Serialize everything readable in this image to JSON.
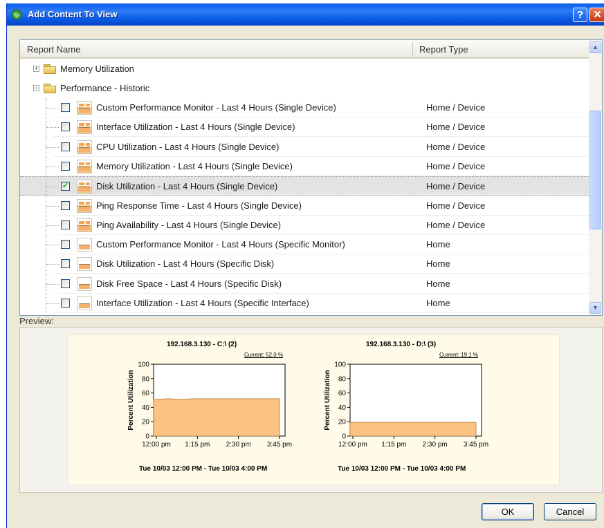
{
  "window": {
    "title": "Add Content To View",
    "help_label": "?",
    "close_label": "✕"
  },
  "list": {
    "headers": {
      "name": "Report Name",
      "type": "Report Type"
    },
    "folders": [
      {
        "label": "Memory Utilization",
        "expander": "+"
      },
      {
        "label": "Performance - Historic",
        "expander": "−"
      }
    ],
    "items": [
      {
        "name": "Custom Performance Monitor - Last 4 Hours (Single Device)",
        "type": "Home / Device",
        "checked": false,
        "check_mark": ""
      },
      {
        "name": "Interface Utilization - Last 4 Hours (Single Device)",
        "type": "Home / Device",
        "checked": false,
        "check_mark": ""
      },
      {
        "name": "CPU Utilization - Last 4 Hours (Single Device)",
        "type": "Home / Device",
        "checked": false,
        "check_mark": ""
      },
      {
        "name": "Memory Utilization - Last 4 Hours (Single Device)",
        "type": "Home / Device",
        "checked": false,
        "check_mark": ""
      },
      {
        "name": "Disk Utilization - Last 4 Hours (Single Device)",
        "type": "Home / Device",
        "checked": true,
        "check_mark": "✓"
      },
      {
        "name": "Ping Response Time - Last 4 Hours (Single Device)",
        "type": "Home / Device",
        "checked": false,
        "check_mark": ""
      },
      {
        "name": "Ping Availability - Last 4 Hours (Single Device)",
        "type": "Home / Device",
        "checked": false,
        "check_mark": ""
      },
      {
        "name": "Custom Performance Monitor - Last 4 Hours (Specific Monitor)",
        "type": "Home",
        "checked": false,
        "check_mark": ""
      },
      {
        "name": "Disk Utilization - Last 4 Hours (Specific Disk)",
        "type": "Home",
        "checked": false,
        "check_mark": ""
      },
      {
        "name": "Disk Free Space - Last 4 Hours (Specific Disk)",
        "type": "Home",
        "checked": false,
        "check_mark": ""
      },
      {
        "name": "Interface Utilization - Last 4 Hours (Specific Interface)",
        "type": "Home",
        "checked": false,
        "check_mark": ""
      }
    ],
    "scroll_up": "▲",
    "scroll_down": "▼"
  },
  "preview": {
    "label": "Preview:",
    "charts": [
      {
        "title": "192.168.3.130 - C:\\ (2)",
        "current": "Current: 52.0 %",
        "range": "Tue 10/03 12:00 PM - Tue 10/03 4:00 PM"
      },
      {
        "title": "192.168.3.130 - D:\\ (3)",
        "current": "Current: 19.1 %",
        "range": "Tue 10/03 12:00 PM - Tue 10/03 4:00 PM"
      }
    ]
  },
  "chart_data": [
    {
      "type": "area",
      "title": "192.168.3.130 - C:\\ (2)",
      "ylabel": "Percent Utilization",
      "ylim": [
        0,
        100
      ],
      "yticks": [
        0,
        20,
        40,
        60,
        80,
        100
      ],
      "xticks": [
        "12:00 pm",
        "1:15 pm",
        "2:30 pm",
        "3:45 pm"
      ],
      "x": [
        0,
        0.12,
        0.22,
        0.32,
        0.45,
        1.0
      ],
      "values": [
        51,
        52,
        51,
        52,
        52,
        52
      ],
      "current": 52.0,
      "color": "#fbc382"
    },
    {
      "type": "area",
      "title": "192.168.3.130 - D:\\ (3)",
      "ylabel": "Percent Utilization",
      "ylim": [
        0,
        100
      ],
      "yticks": [
        0,
        20,
        40,
        60,
        80,
        100
      ],
      "xticks": [
        "12:00 pm",
        "1:15 pm",
        "2:30 pm",
        "3:45 pm"
      ],
      "x": [
        0,
        1.0
      ],
      "values": [
        19.1,
        19.1
      ],
      "current": 19.1,
      "color": "#fbc382"
    }
  ],
  "buttons": {
    "ok": "OK",
    "cancel": "Cancel"
  }
}
